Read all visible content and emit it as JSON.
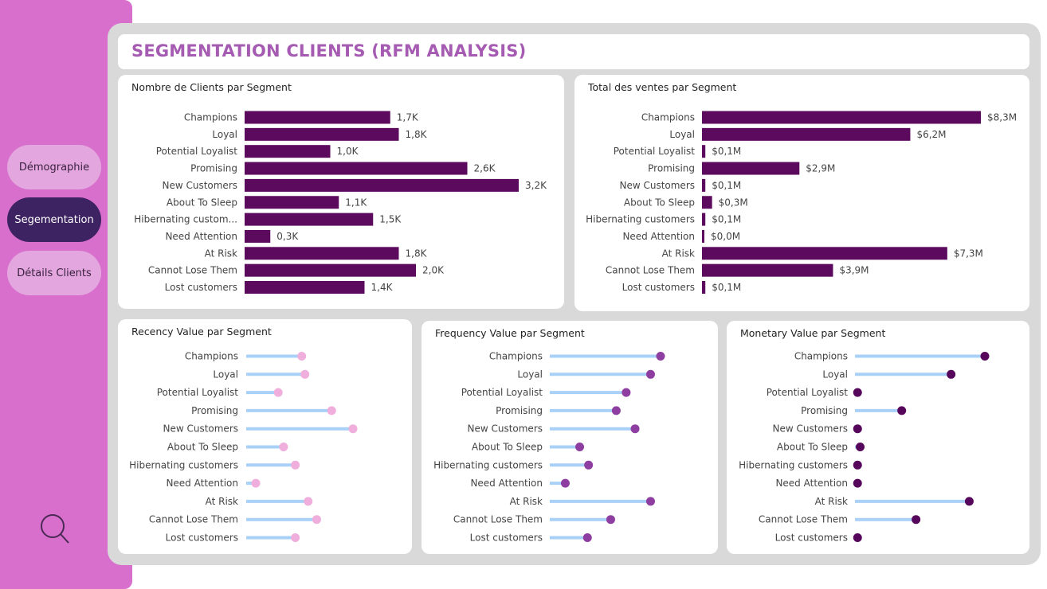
{
  "nav": {
    "items": [
      {
        "label": "Démographie",
        "active": false
      },
      {
        "label": "Segementation",
        "active": true
      },
      {
        "label": "Détails Clients",
        "active": false
      }
    ],
    "search_icon": "search-icon"
  },
  "page": {
    "title": "SEGMENTATION CLIENTS (RFM ANALYSIS)"
  },
  "colors": {
    "sidebar": "#d86fcd",
    "bar": "#5b0a5e",
    "title": "#a65bb2",
    "stem": "#a9d1f7",
    "recency_dot": "#f0aedc",
    "frequency_dot": "#8e3da1",
    "monetary_dot": "#56075c"
  },
  "chart_data": [
    {
      "id": "clients",
      "type": "bar",
      "title": "Nombre de Clients par Segment",
      "categories": [
        "Champions",
        "Loyal",
        "Potential Loyalist",
        "Promising",
        "New Customers",
        "About To Sleep",
        "Hibernating custom...",
        "Need Attention",
        "At Risk",
        "Cannot Lose Them",
        "Lost customers"
      ],
      "values": [
        1.7,
        1.8,
        1.0,
        2.6,
        3.2,
        1.1,
        1.5,
        0.3,
        1.8,
        2.0,
        1.4
      ],
      "labels": [
        "1,7K",
        "1,8K",
        "1,0K",
        "2,6K",
        "3,2K",
        "1,1K",
        "1,5K",
        "0,3K",
        "1,8K",
        "2,0K",
        "1,4K"
      ],
      "unit": "thousands of clients"
    },
    {
      "id": "sales",
      "type": "bar",
      "title": "Total des ventes par Segment",
      "categories": [
        "Champions",
        "Loyal",
        "Potential Loyalist",
        "Promising",
        "New Customers",
        "About To Sleep",
        "Hibernating customers",
        "Need Attention",
        "At Risk",
        "Cannot Lose Them",
        "Lost customers"
      ],
      "values": [
        8.3,
        6.2,
        0.1,
        2.9,
        0.1,
        0.3,
        0.1,
        0.0,
        7.3,
        3.9,
        0.1
      ],
      "labels": [
        "$8,3M",
        "$6,2M",
        "$0,1M",
        "$2,9M",
        "$0,1M",
        "$0,3M",
        "$0,1M",
        "$0,0M",
        "$7,3M",
        "$3,9M",
        "$0,1M"
      ],
      "unit": "million $"
    },
    {
      "id": "recency",
      "type": "lollipop",
      "title": "Recency Value par Segment",
      "categories": [
        "Champions",
        "Loyal",
        "Potential Loyalist",
        "Promising",
        "New Customers",
        "About To Sleep",
        "Hibernating customers",
        "Need Attention",
        "At Risk",
        "Cannot Lose Them",
        "Lost customers"
      ],
      "values": [
        0.52,
        0.55,
        0.3,
        0.8,
        1.0,
        0.35,
        0.46,
        0.09,
        0.58,
        0.66,
        0.46
      ],
      "scale": "relative"
    },
    {
      "id": "frequency",
      "type": "lollipop",
      "title": "Frequency Value par Segment",
      "categories": [
        "Champions",
        "Loyal",
        "Potential Loyalist",
        "Promising",
        "New Customers",
        "About To Sleep",
        "Hibernating customers",
        "Need Attention",
        "At Risk",
        "Cannot Lose Them",
        "Lost customers"
      ],
      "values": [
        1.0,
        0.91,
        0.69,
        0.6,
        0.77,
        0.27,
        0.35,
        0.14,
        0.91,
        0.55,
        0.34
      ],
      "scale": "relative"
    },
    {
      "id": "monetary",
      "type": "lollipop",
      "title": "Monetary Value par Segment",
      "categories": [
        "Champions",
        "Loyal",
        "Potential Loyalist",
        "Promising",
        "New Customers",
        "About To Sleep",
        "Hibernating customers",
        "Need Attention",
        "At Risk",
        "Cannot Lose Them",
        "Lost customers"
      ],
      "values": [
        1.0,
        0.74,
        0.02,
        0.36,
        0.02,
        0.04,
        0.02,
        0.02,
        0.88,
        0.47,
        0.02
      ],
      "scale": "relative"
    }
  ]
}
